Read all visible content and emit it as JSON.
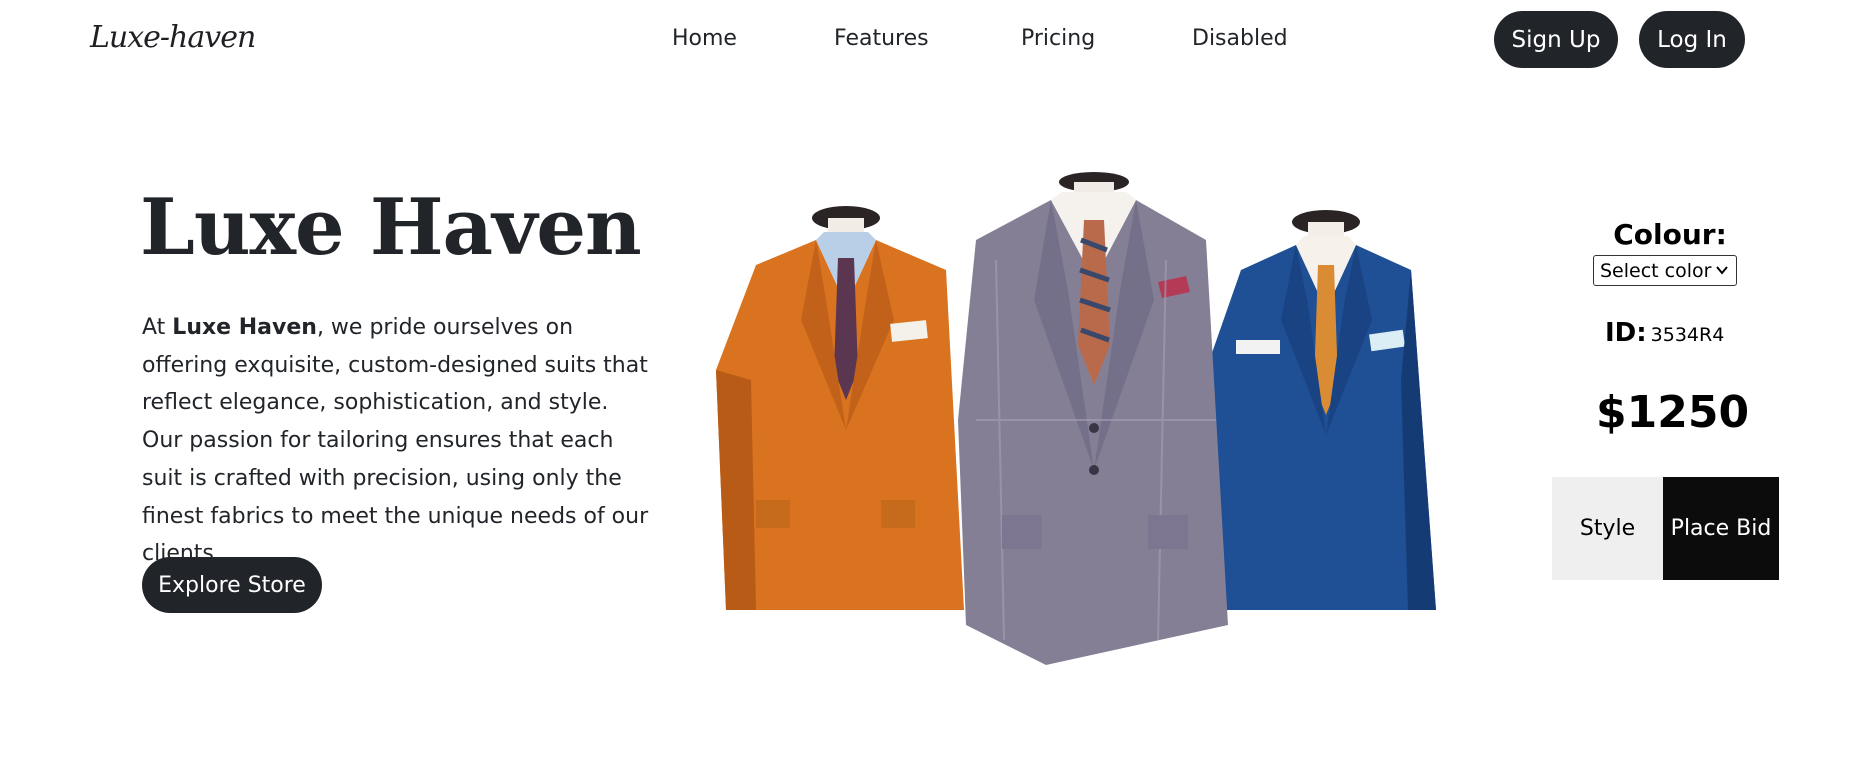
{
  "brand": {
    "logo": "Luxe-haven"
  },
  "nav": {
    "links": [
      "Home",
      "Features",
      "Pricing",
      "Disabled"
    ],
    "signup": "Sign Up",
    "login": "Log In"
  },
  "hero": {
    "title": "Luxe Haven",
    "desc_prefix": "At ",
    "desc_brand": "Luxe Haven",
    "desc_body": ", we pride ourselves on offering exquisite, custom-designed suits that reflect elegance, sophistication, and style. Our passion for tailoring ensures that each suit is crafted with precision, using only the finest fabrics to meet the unique needs of our clients.",
    "cta": "Explore Store"
  },
  "product": {
    "colour_label": "Colour:",
    "select_placeholder": "Select color",
    "id_label": "ID:",
    "id_value": "3534R4",
    "price": "$1250",
    "style_button": "Style",
    "bid_button": "Place Bid"
  },
  "colors": {
    "dark": "#212529",
    "orange_suit": "#d9731f",
    "grey_suit": "#857f95",
    "blue_suit": "#1f4f94"
  }
}
